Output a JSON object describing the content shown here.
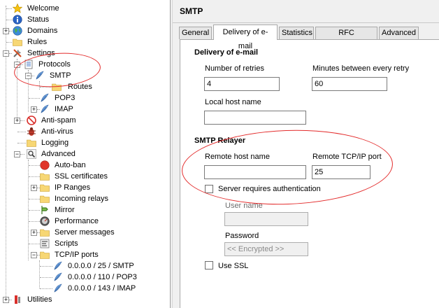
{
  "tree": {
    "items": [
      {
        "label": "Welcome",
        "icon": "star-icon"
      },
      {
        "label": "Status",
        "icon": "info-icon"
      },
      {
        "label": "Domains",
        "icon": "globe-icon"
      },
      {
        "label": "Rules",
        "icon": "folder-icon"
      },
      {
        "label": "Settings",
        "icon": "tools-icon"
      },
      {
        "label": "Protocols",
        "icon": "document-icon"
      },
      {
        "label": "SMTP",
        "icon": "feather-icon"
      },
      {
        "label": "Routes",
        "icon": "folder-icon"
      },
      {
        "label": "POP3",
        "icon": "feather-icon"
      },
      {
        "label": "IMAP",
        "icon": "feather-icon"
      },
      {
        "label": "Anti-spam",
        "icon": "no-entry-icon"
      },
      {
        "label": "Anti-virus",
        "icon": "bug-icon"
      },
      {
        "label": "Logging",
        "icon": "folder-icon"
      },
      {
        "label": "Advanced",
        "icon": "magnifier-icon"
      },
      {
        "label": "Auto-ban",
        "icon": "red-circle-icon"
      },
      {
        "label": "SSL certificates",
        "icon": "folder-icon"
      },
      {
        "label": "IP Ranges",
        "icon": "folder-icon"
      },
      {
        "label": "Incoming relays",
        "icon": "folder-icon"
      },
      {
        "label": "Mirror",
        "icon": "mirror-icon"
      },
      {
        "label": "Performance",
        "icon": "gauge-icon"
      },
      {
        "label": "Server messages",
        "icon": "folder-icon"
      },
      {
        "label": "Scripts",
        "icon": "script-icon"
      },
      {
        "label": "TCP/IP ports",
        "icon": "folder-icon"
      },
      {
        "label": "0.0.0.0 / 25 / SMTP",
        "icon": "feather-icon"
      },
      {
        "label": "0.0.0.0 / 110 / POP3",
        "icon": "feather-icon"
      },
      {
        "label": "0.0.0.0 / 143 / IMAP",
        "icon": "feather-icon"
      },
      {
        "label": "Utilities",
        "icon": "utilities-icon"
      }
    ]
  },
  "panel": {
    "title": "SMTP",
    "tabs": [
      "General",
      "Delivery of e-mail",
      "Statistics",
      "RFC compliance",
      "Advanced"
    ],
    "active_tab": "Delivery of e-mail"
  },
  "delivery": {
    "heading": "Delivery of e-mail",
    "retries_label": "Number of retries",
    "retries_value": "4",
    "minutes_label": "Minutes between every retry",
    "minutes_value": "60",
    "local_host_label": "Local host name",
    "local_host_value": ""
  },
  "relayer": {
    "heading": "SMTP Relayer",
    "remote_host_label": "Remote host name",
    "remote_host_value": "",
    "remote_port_label": "Remote TCP/IP port",
    "remote_port_value": "25",
    "auth_label": "Server requires authentication",
    "auth_checked": false,
    "username_label": "User name",
    "username_value": "",
    "password_label": "Password",
    "password_value": "<< Encrypted >>",
    "ssl_label": "Use SSL",
    "ssl_checked": false
  },
  "colors": {
    "annotation": "#e32b2b",
    "panel_bg": "#f0f0f0"
  }
}
